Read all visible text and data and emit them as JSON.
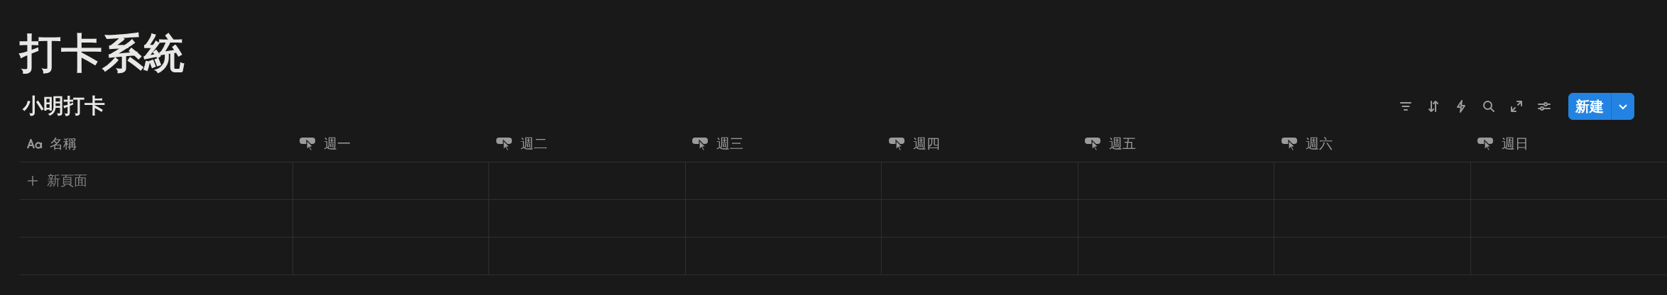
{
  "page": {
    "title": "打卡系統"
  },
  "database": {
    "title": "小明打卡",
    "toolbar": [
      {
        "kind": "filter"
      },
      {
        "kind": "sort"
      },
      {
        "kind": "automation"
      },
      {
        "kind": "search"
      },
      {
        "kind": "expand"
      },
      {
        "kind": "settings"
      }
    ],
    "new_button": {
      "label": "新建"
    },
    "columns": [
      {
        "kind": "title",
        "label": "名稱"
      },
      {
        "kind": "button",
        "label": "週一"
      },
      {
        "kind": "button",
        "label": "週二"
      },
      {
        "kind": "button",
        "label": "週三"
      },
      {
        "kind": "button",
        "label": "週四"
      },
      {
        "kind": "button",
        "label": "週五"
      },
      {
        "kind": "button",
        "label": "週六"
      },
      {
        "kind": "button",
        "label": "週日"
      }
    ],
    "new_row": {
      "label": "新頁面"
    }
  }
}
